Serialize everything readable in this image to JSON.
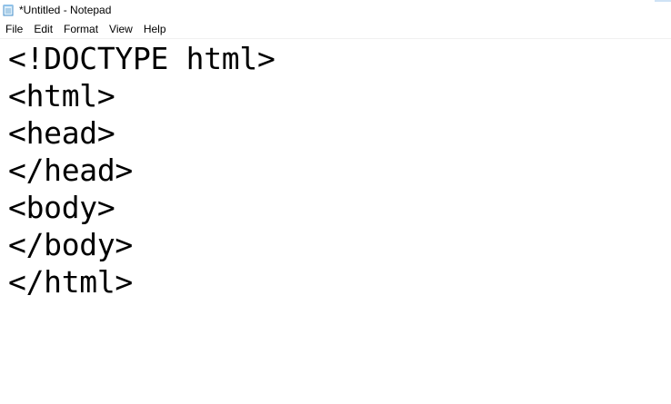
{
  "window": {
    "title": "*Untitled - Notepad",
    "app_icon": "notepad-icon"
  },
  "menu": {
    "items": [
      "File",
      "Edit",
      "Format",
      "View",
      "Help"
    ]
  },
  "editor": {
    "lines": [
      "<!DOCTYPE html>",
      "<html>",
      "<head>",
      "</head>",
      "<body>",
      "</body>",
      "</html>"
    ]
  }
}
